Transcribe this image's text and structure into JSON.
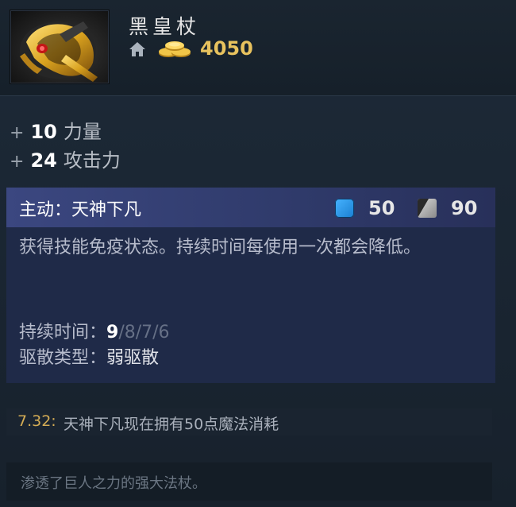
{
  "item": {
    "name": "黑皇杖",
    "cost": "4050",
    "icon": "black-king-bar-image"
  },
  "stats": [
    {
      "plus": "+",
      "value": "10",
      "label": "力量"
    },
    {
      "plus": "+",
      "value": "24",
      "label": "攻击力"
    }
  ],
  "ability": {
    "title": "主动：天神下凡",
    "mana_cost": "50",
    "cooldown": "90",
    "description": "获得技能免疫状态。持续时间每使用一次都会降低。",
    "duration_label": "持续时间：",
    "duration_current": "9",
    "duration_rest": "/8/7/6",
    "dispel_label": "驱散类型：",
    "dispel_value": "弱驱散"
  },
  "patch": {
    "version": "7.32:",
    "text": "天神下凡现在拥有50点魔法消耗"
  },
  "lore": "渗透了巨人之力的强大法杖。",
  "colors": {
    "gold": "#e8c25e",
    "mana": "#1a7fd1",
    "ability_header": "#3b4780",
    "patch_version": "#d4ac55"
  }
}
